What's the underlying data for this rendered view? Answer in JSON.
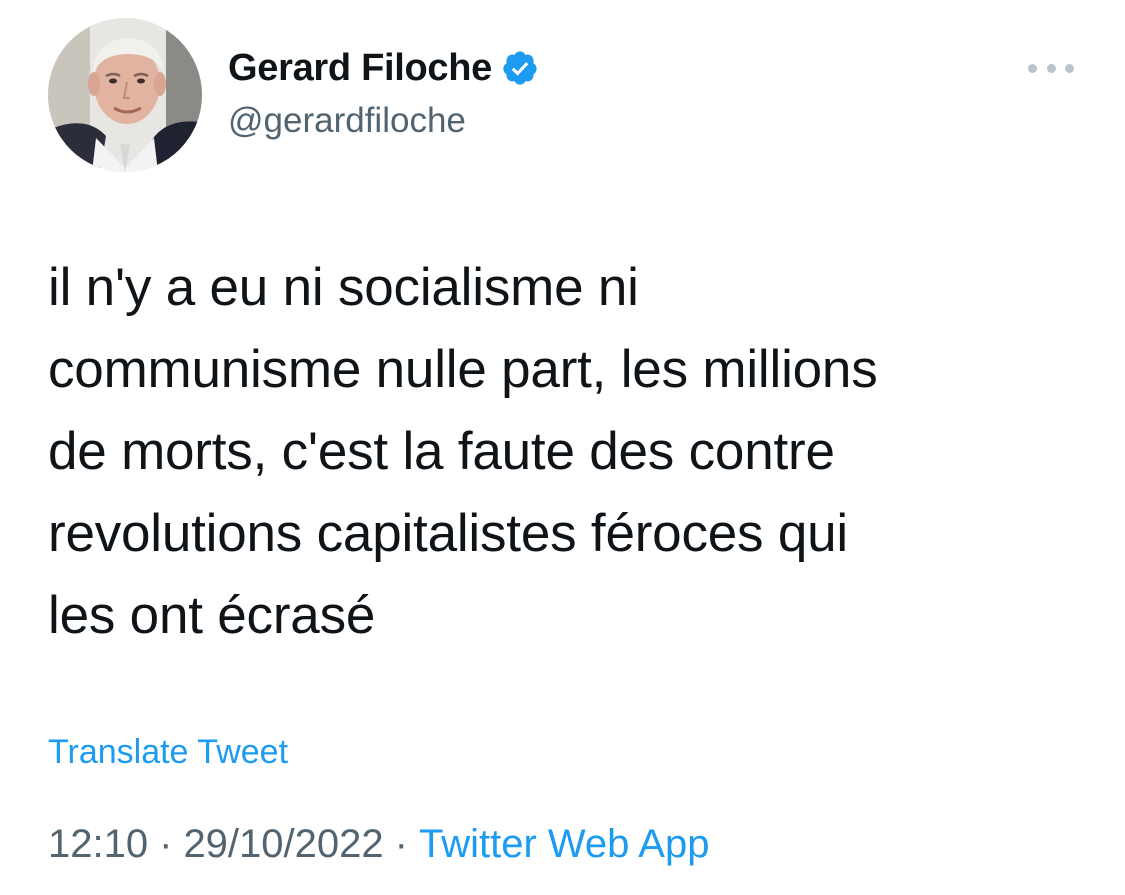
{
  "author": {
    "display_name": "Gerard Filoche",
    "handle": "@gerardfiloche",
    "verified": true,
    "avatar_icon": "profile-photo"
  },
  "tweet": {
    "text": "il n'y a eu ni socialisme ni\ncommunisme nulle part, les millions\nde morts, c'est la faute des contre\nrevolutions capitalistes féroces qui\nles ont écrasé",
    "translate_label": "Translate Tweet",
    "time": "12:10",
    "date": "29/10/2022",
    "separator": "·",
    "source": "Twitter Web App"
  },
  "icons": {
    "more": "more-dots-icon",
    "verified": "verified-badge-icon"
  },
  "colors": {
    "text_primary": "#0f1419",
    "text_secondary": "#536471",
    "accent_blue": "#1d9bf0",
    "verified_blue": "#1d9bf0",
    "more_dots": "#b9c3ca"
  }
}
